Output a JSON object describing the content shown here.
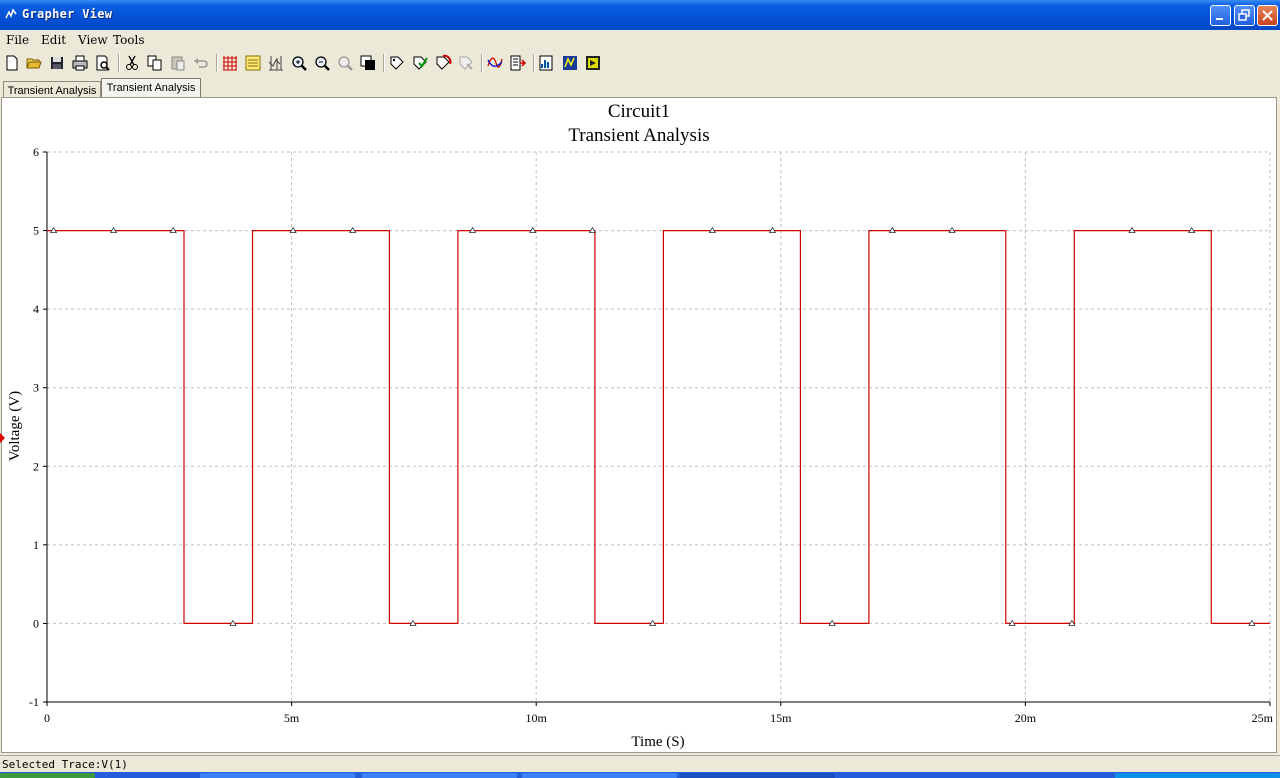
{
  "window": {
    "title": "Grapher View"
  },
  "menu": {
    "items": [
      {
        "label": "File",
        "name": "menu-file"
      },
      {
        "label": "Edit",
        "name": "menu-edit"
      },
      {
        "label": "View",
        "name": "menu-view"
      },
      {
        "label": "Tools",
        "name": "menu-tools"
      }
    ]
  },
  "toolbar": {
    "buttons": [
      "new-icon",
      "open-icon",
      "save-icon",
      "print-icon",
      "print-preview-icon",
      "cut-icon",
      "copy-icon",
      "paste-icon",
      "undo-icon",
      "grid-icon",
      "legend-icon",
      "cursors-icon",
      "zoom-in-icon",
      "zoom-out-icon",
      "zoom-full-icon",
      "reverse-colors-icon",
      "select-marks-icon",
      "export-marks-icon",
      "overlay-traces-icon",
      "properties-icon",
      "add-trace-icon",
      "trace-properties-icon",
      "export-excel-icon",
      "export-mathcad-icon",
      "export-labview-icon"
    ]
  },
  "tabs": [
    {
      "label": "Transient Analysis",
      "active": false
    },
    {
      "label": "Transient Analysis",
      "active": true
    }
  ],
  "chart_data": {
    "type": "line",
    "title": "Circuit1",
    "subtitle": "Transient Analysis",
    "xlabel": "Time (S)",
    "ylabel": "Voltage (V)",
    "xlim": [
      0,
      0.025
    ],
    "ylim": [
      -1,
      6
    ],
    "xticks": [
      {
        "value": 0,
        "label": "0"
      },
      {
        "value": 0.005,
        "label": "5m"
      },
      {
        "value": 0.01,
        "label": "10m"
      },
      {
        "value": 0.015,
        "label": "15m"
      },
      {
        "value": 0.02,
        "label": "20m"
      },
      {
        "value": 0.025,
        "label": "25m"
      }
    ],
    "yticks": [
      -1,
      0,
      1,
      2,
      3,
      4,
      5,
      6
    ],
    "grid": true,
    "series": [
      {
        "color": "#d00000",
        "step": [
          [
            0,
            5
          ],
          [
            0.0028,
            5
          ],
          [
            0.0028,
            0
          ],
          [
            0.0042,
            0
          ],
          [
            0.0042,
            5
          ],
          [
            0.007,
            5
          ],
          [
            0.007,
            0
          ],
          [
            0.0084,
            0
          ],
          [
            0.0084,
            5
          ],
          [
            0.0112,
            5
          ],
          [
            0.0112,
            0
          ],
          [
            0.0126,
            0
          ],
          [
            0.0126,
            5
          ],
          [
            0.0154,
            5
          ],
          [
            0.0154,
            0
          ],
          [
            0.0168,
            0
          ],
          [
            0.0168,
            5
          ],
          [
            0.0196,
            5
          ],
          [
            0.0196,
            0
          ],
          [
            0.021,
            0
          ],
          [
            0.021,
            5
          ],
          [
            0.0238,
            5
          ],
          [
            0.0238,
            0
          ],
          [
            0.025,
            0
          ]
        ],
        "markers": [
          [
            0.000135,
            5
          ],
          [
            0.00136,
            5
          ],
          [
            0.00258,
            5
          ],
          [
            0.0038,
            0
          ],
          [
            0.00503,
            5
          ],
          [
            0.00625,
            5
          ],
          [
            0.00748,
            0
          ],
          [
            0.0087,
            5
          ],
          [
            0.00993,
            5
          ],
          [
            0.01115,
            5
          ],
          [
            0.01238,
            0
          ],
          [
            0.0136,
            5
          ],
          [
            0.01483,
            5
          ],
          [
            0.01605,
            0
          ],
          [
            0.01728,
            5
          ],
          [
            0.0185,
            5
          ],
          [
            0.01973,
            0
          ],
          [
            0.02095,
            0
          ],
          [
            0.02218,
            5
          ],
          [
            0.0234,
            5
          ],
          [
            0.02463,
            0
          ]
        ]
      }
    ]
  },
  "status": {
    "text": "Selected Trace:V(1)"
  },
  "colors": {
    "trace": "#d00000",
    "titlebar": "#0350d6",
    "grid": "#c0c0c0"
  }
}
